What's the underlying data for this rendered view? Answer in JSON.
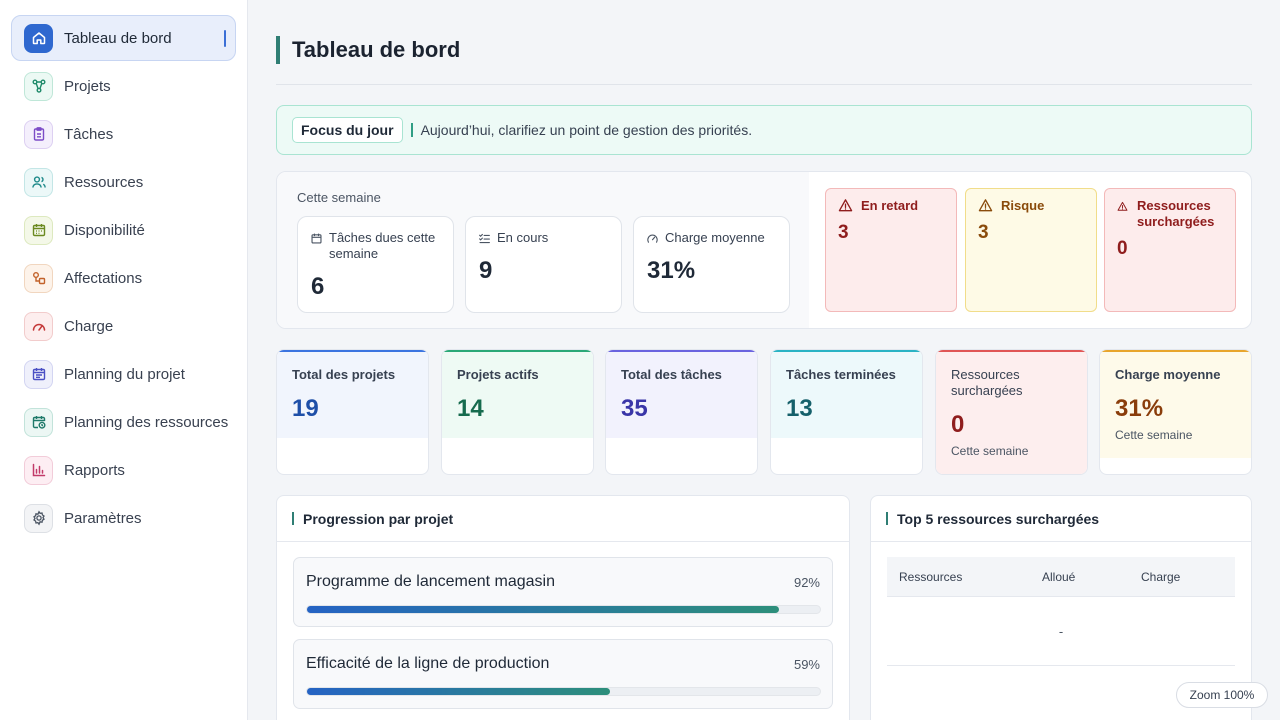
{
  "sidebar": {
    "items": [
      {
        "label": "Tableau de bord",
        "icon": "home-icon",
        "color": "#ffffff",
        "bg": "#2f68cf",
        "border": "#2f68cf"
      },
      {
        "label": "Projets",
        "icon": "project-network-icon",
        "color": "#1f8a6a",
        "bg": "#ecf9f4",
        "border": "#bfe7d8"
      },
      {
        "label": "Tâches",
        "icon": "clipboard-icon",
        "color": "#7c4cc7",
        "bg": "#f4effc",
        "border": "#ddd0f2"
      },
      {
        "label": "Ressources",
        "icon": "users-icon",
        "color": "#1f8a8a",
        "bg": "#ecf8f8",
        "border": "#c3e6e6"
      },
      {
        "label": "Disponibilité",
        "icon": "calendar-icon",
        "color": "#6b8a1f",
        "bg": "#f4f8e8",
        "border": "#dde9bf"
      },
      {
        "label": "Affectations",
        "icon": "assignment-icon",
        "color": "#c2622a",
        "bg": "#fdf3ea",
        "border": "#f1d6bf"
      },
      {
        "label": "Charge",
        "icon": "gauge-icon",
        "color": "#c53a3a",
        "bg": "#fdeeee",
        "border": "#f2cccc"
      },
      {
        "label": "Planning du projet",
        "icon": "calendar-list-icon",
        "color": "#4a4fc4",
        "bg": "#eff0fb",
        "border": "#d3d5f2"
      },
      {
        "label": "Planning des ressources",
        "icon": "calendar-clock-icon",
        "color": "#1f7a6a",
        "bg": "#ecf7f4",
        "border": "#c2e3da"
      },
      {
        "label": "Rapports",
        "icon": "bar-chart-icon",
        "color": "#c23a6a",
        "bg": "#fdeef3",
        "border": "#f2ccd9"
      },
      {
        "label": "Paramètres",
        "icon": "gear-icon",
        "color": "#4b5563",
        "bg": "#f3f4f6",
        "border": "#dde0e5"
      }
    ]
  },
  "header": {
    "title": "Tableau de bord"
  },
  "focus": {
    "tag": "Focus du jour",
    "text": "Aujourd’hui, clarifiez un point de gestion des priorités."
  },
  "week": {
    "title": "Cette semaine",
    "cards": [
      {
        "label": "Tâches dues cette semaine",
        "value": "6",
        "icon": "calendar-small-icon"
      },
      {
        "label": "En cours",
        "value": "9",
        "icon": "list-check-icon"
      },
      {
        "label": "Charge moyenne",
        "value": "31%",
        "icon": "gauge-small-icon"
      }
    ],
    "alerts": [
      {
        "label": "En retard",
        "value": "3",
        "color": "#8f1d1d",
        "bg": "#fdecec",
        "border": "#f3b9b9"
      },
      {
        "label": "Risque",
        "value": "3",
        "color": "#8a4b0b",
        "bg": "#fefae6",
        "border": "#f1dd8a"
      },
      {
        "label": "Ressources surchargées",
        "value": "0",
        "color": "#8f1d1d",
        "bg": "#fdecec",
        "border": "#f3b9b9"
      }
    ]
  },
  "stats": [
    {
      "label": "Total des projets",
      "value": "19",
      "sub": "",
      "color": "#1e4fa8",
      "accent": "#3b74e0",
      "bg": "#f1f5fd"
    },
    {
      "label": "Projets actifs",
      "value": "14",
      "sub": "",
      "color": "#166b4e",
      "accent": "#2aa877",
      "bg": "#eefaf4"
    },
    {
      "label": "Total des tâches",
      "value": "35",
      "sub": "",
      "color": "#3a36a8",
      "accent": "#6a63df",
      "bg": "#f2f2fd"
    },
    {
      "label": "Tâches terminées",
      "value": "13",
      "sub": "",
      "color": "#15606a",
      "accent": "#2ab3c4",
      "bg": "#edf9fb"
    },
    {
      "label": "Ressources surchargées",
      "value": "0",
      "sub": "Cette semaine",
      "color": "#8f1d1d",
      "accent": "#e05555",
      "bg": "#fdeeee"
    },
    {
      "label": "Charge moyenne",
      "value": "31%",
      "sub": "Cette semaine",
      "color": "#8a3d0b",
      "accent": "#e8a52c",
      "bg": "#fefaea"
    }
  ],
  "progress": {
    "title": "Progression par projet",
    "projects": [
      {
        "name": "Programme de lancement magasin",
        "percent_label": "92%",
        "percent": 92
      },
      {
        "name": "Efficacité de la ligne de production",
        "percent_label": "59%",
        "percent": 59
      }
    ]
  },
  "top_resources": {
    "title": "Top 5 ressources surchargées",
    "columns": [
      "Ressources",
      "Alloué",
      "Charge"
    ],
    "empty": "-"
  },
  "zoom": {
    "label": "Zoom 100%"
  }
}
